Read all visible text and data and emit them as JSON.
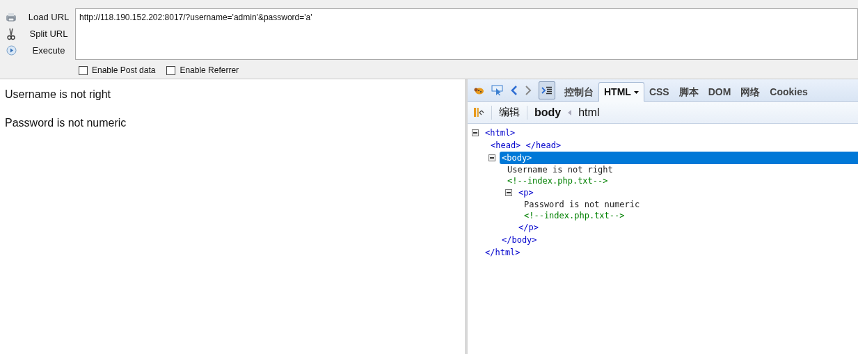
{
  "sidebar_actions": [
    {
      "label": "Load URL",
      "kind": "load"
    },
    {
      "label": "Split URL",
      "kind": "split"
    },
    {
      "label": "Execute",
      "kind": "execute"
    }
  ],
  "url_field": {
    "value": "http://118.190.152.202:8017/?username='admin'&password='a'"
  },
  "options": [
    {
      "label": "Enable Post data",
      "checked": false
    },
    {
      "label": "Enable Referrer",
      "checked": false
    }
  ],
  "page_content": [
    "Username is not right",
    "Password is not numeric"
  ],
  "devtools": {
    "tabs": [
      {
        "label": "控制台",
        "selected": false,
        "dropdown": false
      },
      {
        "label": "HTML",
        "selected": true,
        "dropdown": true
      },
      {
        "label": "CSS",
        "selected": false,
        "dropdown": false
      },
      {
        "label": "脚本",
        "selected": false,
        "dropdown": false
      },
      {
        "label": "DOM",
        "selected": false,
        "dropdown": false
      },
      {
        "label": "网络",
        "selected": false,
        "dropdown": false
      },
      {
        "label": "Cookies",
        "selected": false,
        "dropdown": false
      }
    ],
    "edit_button": "编辑",
    "breadcrumbs": [
      {
        "label": "body",
        "selected": true
      },
      {
        "label": "html",
        "selected": false
      }
    ],
    "tree": [
      {
        "kind": "element",
        "tag": "<html>",
        "expanded": true,
        "selected": false,
        "close": "</html>",
        "children": [
          {
            "kind": "leaf",
            "tag": "<head> </head>",
            "selected": false
          },
          {
            "kind": "element",
            "tag": "<body>",
            "expanded": true,
            "selected": true,
            "close": "</body>",
            "children": [
              {
                "kind": "text",
                "text": "Username is not right"
              },
              {
                "kind": "comment",
                "text": "<!--index.php.txt-->"
              },
              {
                "kind": "element",
                "tag": "<p>",
                "expanded": true,
                "selected": false,
                "close": "</p>",
                "children": [
                  {
                    "kind": "text",
                    "text": "Password is not numeric"
                  },
                  {
                    "kind": "comment",
                    "text": "<!--index.php.txt-->"
                  }
                ]
              }
            ]
          }
        ]
      }
    ]
  }
}
